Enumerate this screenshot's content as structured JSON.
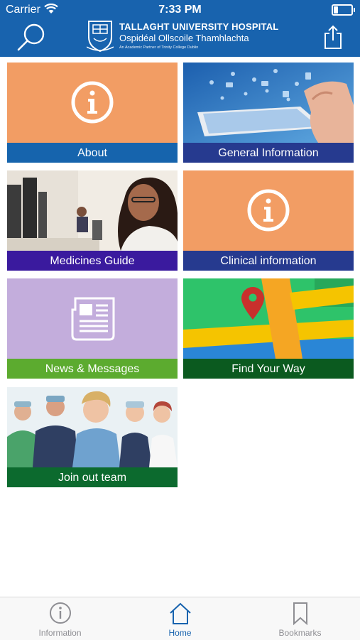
{
  "status_bar": {
    "carrier": "Carrier",
    "time": "7:33 PM",
    "battery_level": 0.25
  },
  "header": {
    "title": "TALLAGHT UNIVERSITY HOSPITAL",
    "subtitle": "Ospidéal Ollscoile Thamhlachta",
    "tagline": "An Academic Partner of Trinity College Dublin",
    "search_icon": "search-icon",
    "share_icon": "share-icon"
  },
  "tiles": [
    {
      "label": "About",
      "bg": "#f29d64",
      "bar": "#1664ad",
      "icon": "info-icon"
    },
    {
      "label": "General Information",
      "bg": "#2a6fb7",
      "bar": "#263a8f",
      "icon": "tablet-photo"
    },
    {
      "label": "Medicines Guide",
      "bg": "#d9d2c7",
      "bar": "#3a1a9e",
      "icon": "office-photo"
    },
    {
      "label": "Clinical information",
      "bg": "#f29d64",
      "bar": "#263a8f",
      "icon": "info-icon"
    },
    {
      "label": "News & Messages",
      "bg": "#c3addc",
      "bar": "#5cab2f",
      "icon": "newspaper-icon"
    },
    {
      "label": "Find Your Way",
      "bg": "#2ec36a",
      "bar": "#0b5a1f",
      "icon": "map-pin-icon"
    },
    {
      "label": "Join out team",
      "bg": "#eaf1f4",
      "bar": "#0c6a2e",
      "icon": "staff-photo"
    }
  ],
  "tabbar": {
    "items": [
      {
        "label": "Information",
        "icon": "info-circle-icon",
        "active": false
      },
      {
        "label": "Home",
        "icon": "home-icon",
        "active": true
      },
      {
        "label": "Bookmarks",
        "icon": "bookmark-icon",
        "active": false
      }
    ]
  },
  "colors": {
    "header": "#1863ae",
    "active_tab": "#1863ae",
    "inactive_tab": "#8e8e93"
  }
}
